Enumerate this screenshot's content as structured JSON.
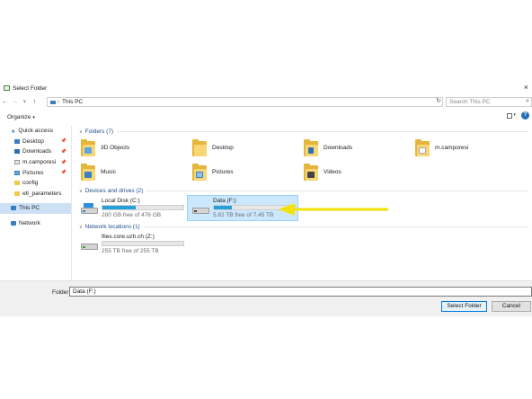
{
  "window": {
    "title": "Select Folder"
  },
  "nav": {
    "back_icon": "arrow-left-icon",
    "forward_icon": "arrow-right-icon",
    "recent_icon": "chevron-down-icon",
    "up_icon": "arrow-up-icon",
    "breadcrumb": [
      "This PC"
    ],
    "search_placeholder": "Search This PC"
  },
  "toolbar": {
    "organize_label": "Organize"
  },
  "sidebar": {
    "quick_access": "Quick access",
    "items": [
      {
        "label": "Desktop",
        "icon": "desktop-icon",
        "pinned": true
      },
      {
        "label": "Downloads",
        "icon": "downloads-icon",
        "pinned": true
      },
      {
        "label": "m.camporesi",
        "icon": "documents-icon",
        "pinned": true
      },
      {
        "label": "Pictures",
        "icon": "pictures-icon",
        "pinned": true
      },
      {
        "label": "config",
        "icon": "folder-icon",
        "pinned": false
      },
      {
        "label": "etl_parameters",
        "icon": "folder-icon",
        "pinned": false
      }
    ],
    "this_pc": "This PC",
    "network": "Network"
  },
  "groups": {
    "folders": {
      "title": "Folders (7)"
    },
    "drives": {
      "title": "Devices and drives (2)"
    },
    "network": {
      "title": "Network locations (1)"
    }
  },
  "folders": [
    {
      "label": "3D Objects",
      "badge": "cube-badge"
    },
    {
      "label": "Desktop",
      "badge": "none"
    },
    {
      "label": "Downloads",
      "badge": "download-badge"
    },
    {
      "label": "m.camporesi",
      "badge": "document-badge"
    },
    {
      "label": "Music",
      "badge": "music-badge"
    },
    {
      "label": "Pictures",
      "badge": "picture-badge"
    },
    {
      "label": "Videos",
      "badge": "film-badge"
    }
  ],
  "drives": [
    {
      "name": "Local Disk (C:)",
      "free": "280 GB free of 476 GB",
      "used_fraction": 0.41,
      "selected": false
    },
    {
      "name": "Data (F:)",
      "free": "5.82 TB free of 7.45 TB",
      "used_fraction": 0.22,
      "selected": true
    }
  ],
  "network_locations": [
    {
      "name": "files.core.uzh.ch (Z:)",
      "free": "255 TB free of 255 TB",
      "used_fraction": 0.0
    }
  ],
  "footer": {
    "folder_label": "Folder:",
    "folder_value": "Data (F:)",
    "select_label": "Select Folder",
    "cancel_label": "Cancel"
  },
  "colors": {
    "selection": "#cce8ff",
    "drive_fill": "#26a0da",
    "annotation_arrow": "#f2e20a",
    "accent": "#0078d7"
  }
}
